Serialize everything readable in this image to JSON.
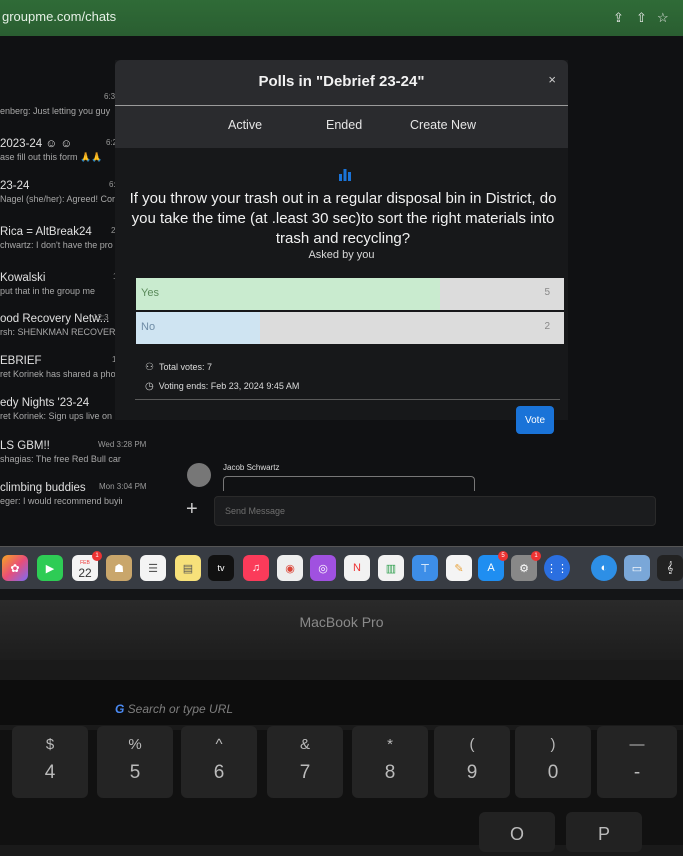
{
  "browser": {
    "url": "groupme.com/chats"
  },
  "chats": [
    {
      "name": "",
      "preview": "enberg: Just letting you guy",
      "time": "6:3"
    },
    {
      "name": "2023-24 ☺ ☺",
      "preview": "ase fill out this form 🙏🙏",
      "time": "6:2"
    },
    {
      "name": "23-24",
      "preview": "Nagel (she/her): Agreed! Cor",
      "time": "6:1"
    },
    {
      "name": "Rica = AltBreak24",
      "preview": "chwartz: I don't have the pro",
      "time": "2:5"
    },
    {
      "name": "Kowalski",
      "preview": "put that in the group me",
      "time": "1:"
    },
    {
      "name": "ood Recovery Netw...",
      "preview": "rsh: SHENKMAN RECOVERY",
      "time": "12:3"
    },
    {
      "name": "EBRIEF",
      "preview": "ret Korinek has shared a photo",
      "time": "12:1"
    },
    {
      "name": "edy Nights '23-24",
      "preview": "ret Korinek: Sign ups live on insta",
      "time": "9:5"
    },
    {
      "name": "LS GBM!!",
      "preview": "shagias: The free Red Bull car is in...",
      "time": "Wed 3:28 PM"
    },
    {
      "name": "climbing buddies",
      "preview": "eger: I would recommend buying a...",
      "time": "Mon 3:04 PM"
    }
  ],
  "modal": {
    "title": "Polls in \"Debrief 23-24\"",
    "close": "×",
    "tabs": {
      "active": "Active",
      "ended": "Ended",
      "create": "Create New"
    }
  },
  "poll": {
    "question": "If you throw your trash out in a regular disposal bin in District, do you take the time (at .least 30 sec)to sort the right materials into trash and recycling?",
    "asked_by": "Asked by you",
    "options": [
      {
        "label": "Yes",
        "count": "5",
        "fraction": 0.71,
        "color": "#c9ebcf"
      },
      {
        "label": "No",
        "count": "2",
        "fraction": 0.29,
        "color": "#cfe4f2"
      }
    ],
    "total_votes": "Total votes: 7",
    "voting_ends": "Voting ends: Feb 23, 2024 9:45 AM",
    "vote_button": "Vote"
  },
  "message": {
    "author": "Jacob Schwartz",
    "input_placeholder": "Send Message"
  },
  "dock": {
    "calendar_month": "FEB",
    "calendar_day": "22",
    "tv_label": "tv",
    "badge_calendar": "1",
    "badge_appstore": "5",
    "badge_settings": "1"
  },
  "laptop": {
    "label": "MacBook Pro",
    "touchbar_search": "Search or type URL"
  },
  "keys": [
    {
      "up": "$",
      "down": "4"
    },
    {
      "up": "%",
      "down": "5"
    },
    {
      "up": "^",
      "down": "6"
    },
    {
      "up": "&",
      "down": "7"
    },
    {
      "up": "*",
      "down": "8"
    },
    {
      "up": "(",
      "down": "9"
    },
    {
      "up": ")",
      "down": "0"
    },
    {
      "up": "—",
      "down": "-"
    }
  ],
  "keys_bottom": [
    "O",
    "P"
  ],
  "colors": {
    "accent": "#1a73d8",
    "browser_bar": "#2f6b37"
  }
}
